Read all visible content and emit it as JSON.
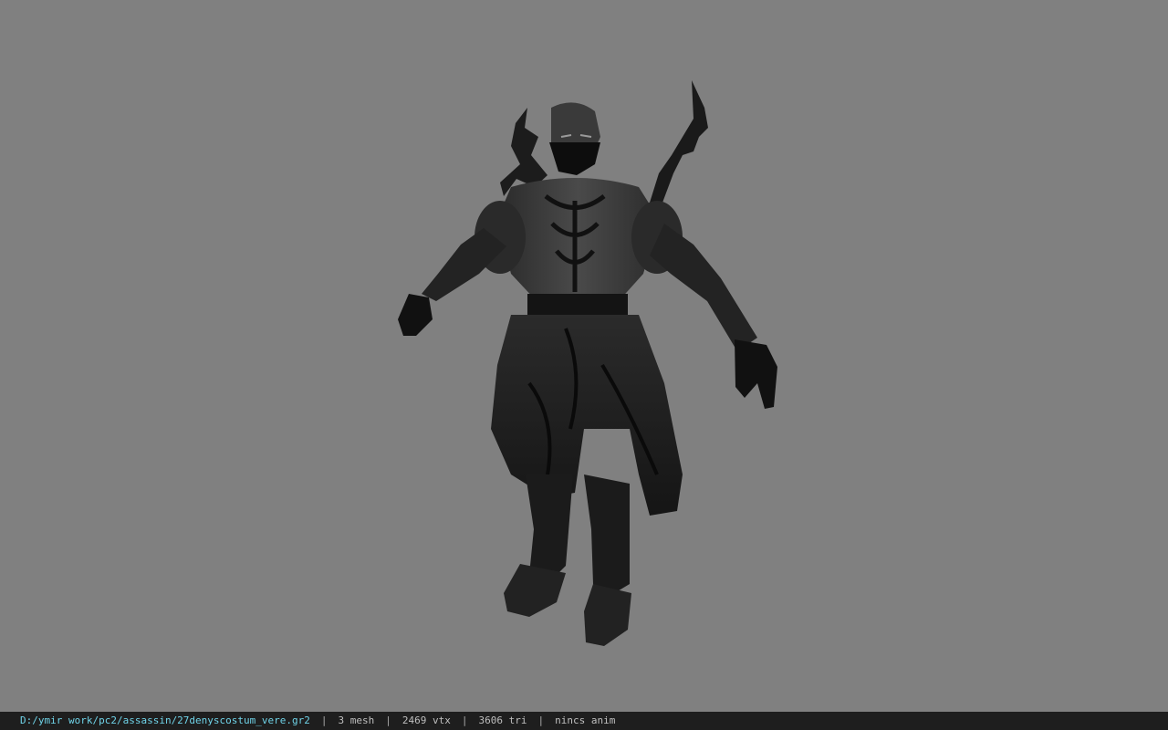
{
  "status_bar": {
    "file_path": "D:/ymir work/pc2/assassin/27denyscostum_vere.gr2",
    "separator": "|",
    "mesh_count": "3 mesh",
    "vertex_count": "2469 vtx",
    "triangle_count": "3606 tri",
    "animation": "nincs anim"
  },
  "viewport": {
    "background_color": "#808080",
    "model_color": "#202020"
  }
}
